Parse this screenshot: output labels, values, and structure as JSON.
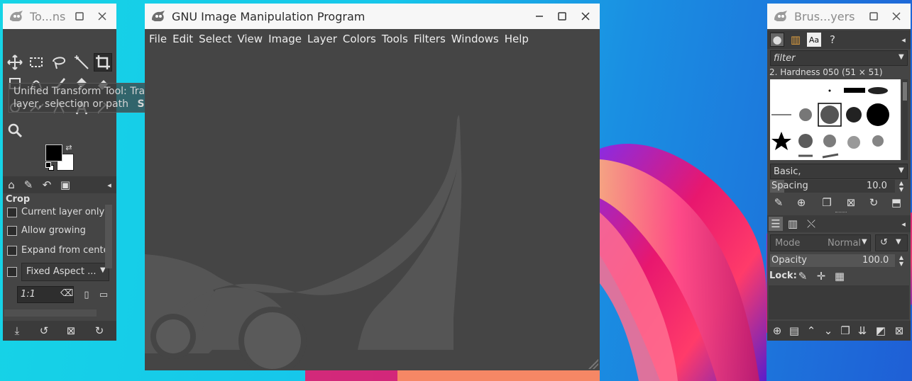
{
  "toolbox": {
    "title": "To...ns",
    "tooltip_text": "Unified Transform Tool: Transform the layer, selection or path",
    "tooltip_shortcut": "Shift+T",
    "options": {
      "tool_name": "Crop",
      "current_layer_only": "Current layer only",
      "allow_growing": "Allow growing",
      "expand_from_center": "Expand from cente",
      "fixed_aspect": "Fixed Aspect ...",
      "ratio_value": "1:1"
    }
  },
  "main": {
    "title": "GNU Image Manipulation Program",
    "menu": [
      "File",
      "Edit",
      "Select",
      "View",
      "Image",
      "Layer",
      "Colors",
      "Tools",
      "Filters",
      "Windows",
      "Help"
    ]
  },
  "right": {
    "title": "Brus...yers",
    "filter_placeholder": "filter",
    "brush_name": "2. Hardness 050 (51 × 51)",
    "preset": "Basic,",
    "spacing_label": "Spacing",
    "spacing_value": "10.0",
    "mode_label": "Mode",
    "mode_value": "Normal",
    "opacity_label": "Opacity",
    "opacity_value": "100.0",
    "opacity_level": 1.0,
    "lock_label": "Lock:"
  },
  "colors": {
    "panel": "#454545",
    "titlebar": "#f7f7f7",
    "fg_color": "#000000",
    "bg_color": "#ffffff"
  }
}
